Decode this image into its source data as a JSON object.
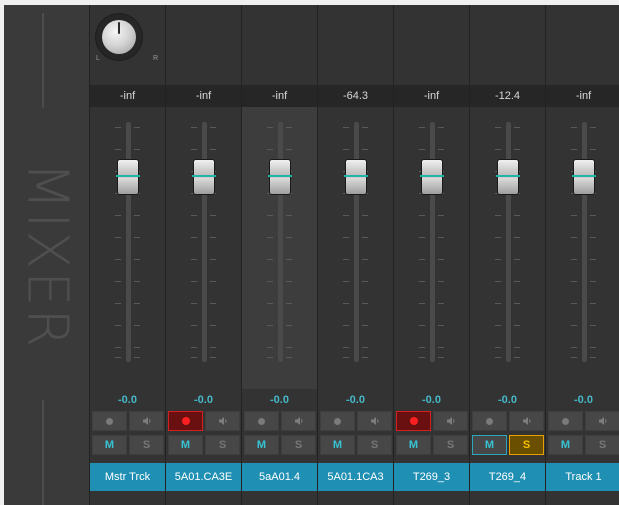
{
  "panel_title": "MIXER",
  "knob": {
    "left_label": "L",
    "right_label": "R"
  },
  "channels": [
    {
      "name": "Mstr Trck",
      "meter": "-inf",
      "gain": "-0.0",
      "rec_armed": false,
      "mute_label": "M",
      "solo_label": "S",
      "is_master": true,
      "selected": false,
      "mute_outline": false,
      "solo_on": false
    },
    {
      "name": "5A01.CA3E",
      "meter": "-inf",
      "gain": "-0.0",
      "rec_armed": true,
      "mute_label": "M",
      "solo_label": "S",
      "is_master": false,
      "selected": false,
      "mute_outline": false,
      "solo_on": false
    },
    {
      "name": "5aA01.4",
      "meter": "-inf",
      "gain": "-0.0",
      "rec_armed": false,
      "mute_label": "M",
      "solo_label": "S",
      "is_master": false,
      "selected": true,
      "mute_outline": false,
      "solo_on": false
    },
    {
      "name": "5A01.1CA3",
      "meter": "-64.3",
      "gain": "-0.0",
      "rec_armed": false,
      "mute_label": "M",
      "solo_label": "S",
      "is_master": false,
      "selected": false,
      "mute_outline": false,
      "solo_on": false
    },
    {
      "name": "T269_3",
      "meter": "-inf",
      "gain": "-0.0",
      "rec_armed": true,
      "mute_label": "M",
      "solo_label": "S",
      "is_master": false,
      "selected": false,
      "mute_outline": false,
      "solo_on": false
    },
    {
      "name": "T269_4",
      "meter": "-12.4",
      "gain": "-0.0",
      "rec_armed": false,
      "mute_label": "M",
      "solo_label": "S",
      "is_master": false,
      "selected": false,
      "mute_outline": true,
      "solo_on": true
    },
    {
      "name": "Track  1",
      "meter": "-inf",
      "gain": "-0.0",
      "rec_armed": false,
      "mute_label": "M",
      "solo_label": "S",
      "is_master": false,
      "selected": false,
      "mute_outline": false,
      "solo_on": false
    }
  ],
  "colors": {
    "accent_teal": "#46b8c8",
    "track_name_bg": "#1f8fb3",
    "rec_red": "#ff2020",
    "solo_yellow": "#f6c000"
  }
}
